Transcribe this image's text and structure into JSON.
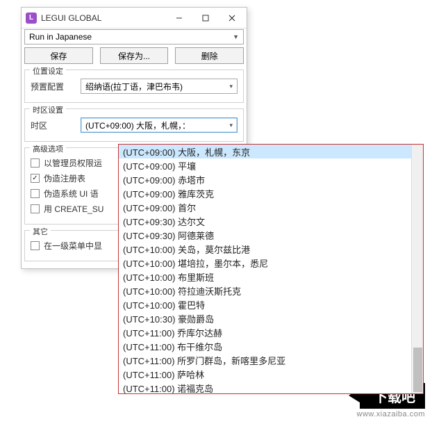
{
  "window": {
    "icon_letter": "L",
    "title": "LEGUI GLOBAL"
  },
  "lang_select": {
    "value": "Run in Japanese"
  },
  "buttons": {
    "save": "保存",
    "saveas": "保存为...",
    "delete": "删除"
  },
  "sections": {
    "location": {
      "legend": "位置设定",
      "preset_label": "预置配置",
      "preset_value": "绍纳语(拉丁语，津巴布韦)"
    },
    "timezone": {
      "legend": "时区设置",
      "tz_label": "时区",
      "tz_value": "(UTC+09:00) 大阪，札幌，："
    },
    "advanced": {
      "legend": "高级选项",
      "opt1": "以管理员权限运",
      "opt2": "伪造注册表",
      "opt3": "伪造系统 UI 语",
      "opt4": "用 CREATE_SU"
    },
    "other": {
      "legend": "其它",
      "opt1": "在一级菜单中显"
    }
  },
  "dropdown": {
    "items": [
      "(UTC+09:00) 大阪，札幌，东京",
      "(UTC+09:00) 平壤",
      "(UTC+09:00) 赤塔市",
      "(UTC+09:00) 雅库茨克",
      "(UTC+09:00) 首尔",
      "(UTC+09:30) 达尔文",
      "(UTC+09:30) 阿德莱德",
      "(UTC+10:00) 关岛，莫尔兹比港",
      "(UTC+10:00) 堪培拉，墨尔本，悉尼",
      "(UTC+10:00) 布里斯班",
      "(UTC+10:00) 符拉迪沃斯托克",
      "(UTC+10:00) 霍巴特",
      "(UTC+10:30) 豪勋爵岛",
      "(UTC+11:00) 乔库尔达赫",
      "(UTC+11:00) 布干维尔岛",
      "(UTC+11:00) 所罗门群岛，新喀里多尼亚",
      "(UTC+11:00) 萨哈林",
      "(UTC+11:00) 诺福克岛"
    ]
  },
  "watermark": {
    "text": "下载吧",
    "url": "www.xiazaiba.com"
  }
}
